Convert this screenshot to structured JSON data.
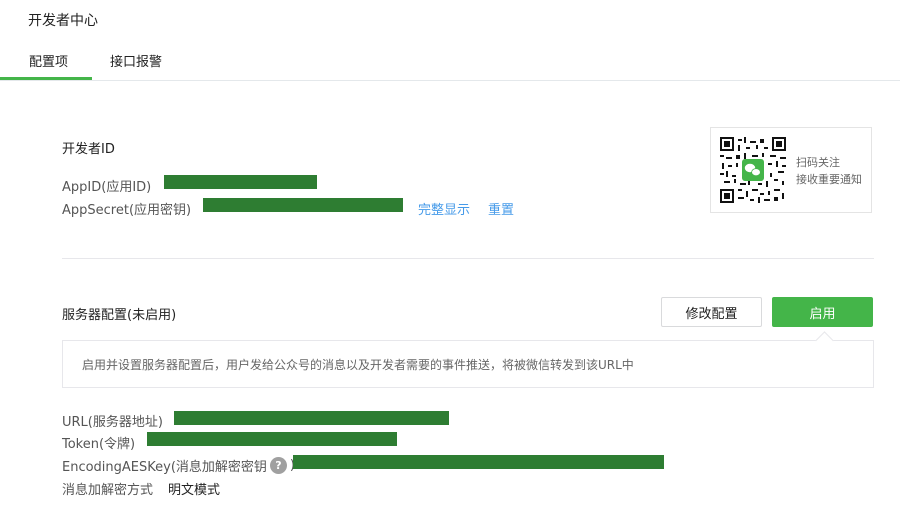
{
  "page": {
    "title": "开发者中心"
  },
  "tabs": [
    {
      "label": "配置项",
      "active": true
    },
    {
      "label": "接口报警",
      "active": false
    }
  ],
  "developer": {
    "heading": "开发者ID",
    "appid_label": "AppID(应用ID)",
    "appsecret_label": "AppSecret(应用密钥)",
    "show_full_link": "完整显示",
    "reset_link": "重置"
  },
  "qr": {
    "line1": "扫码关注",
    "line2": "接收重要通知"
  },
  "server": {
    "heading": "服务器配置(未启用)",
    "modify_button": "修改配置",
    "enable_button": "启用",
    "notice": "启用并设置服务器配置后，用户发给公众号的消息以及开发者需要的事件推送，将被微信转发到该URL中",
    "url_label": "URL(服务器地址)",
    "token_label": "Token(令牌)",
    "aeskey_label": "EncodingAESKey(消息加解密密钥",
    "encrypt_mode_label": "消息加解密方式",
    "encrypt_mode_value": "明文模式"
  },
  "colors": {
    "accent_green": "#44b549",
    "link_blue": "#459ae9",
    "redaction_green": "#2e7d32"
  }
}
